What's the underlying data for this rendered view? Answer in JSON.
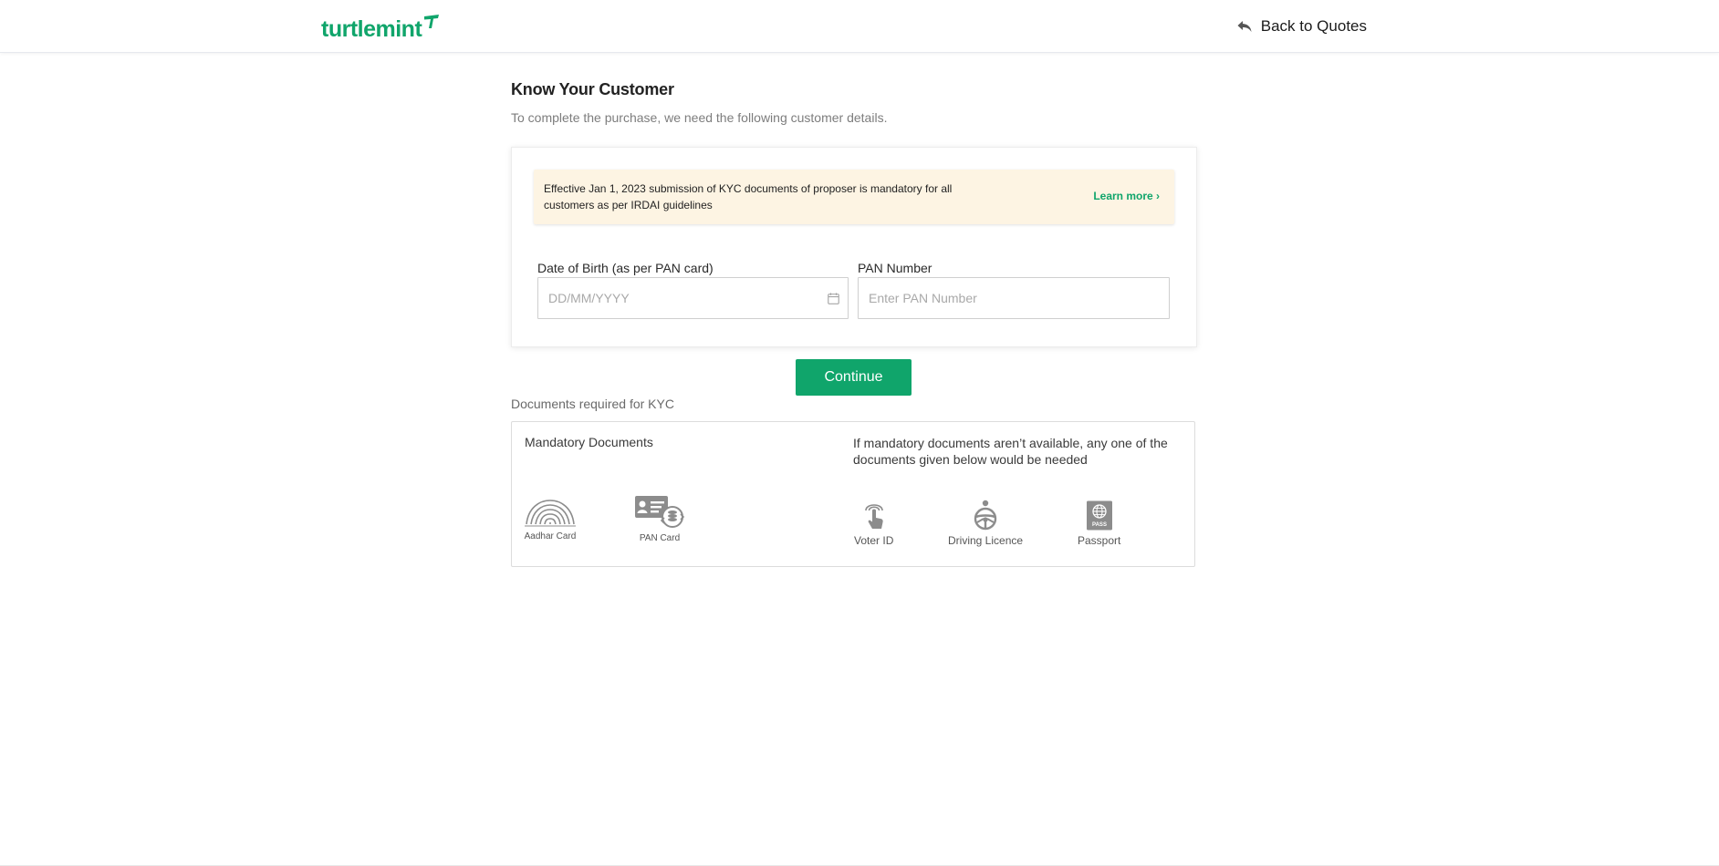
{
  "header": {
    "logo_text": "turtlemint",
    "back_label": "Back to Quotes",
    "brand_color": "#10a56b"
  },
  "page": {
    "title": "Know Your Customer",
    "subtitle": "To complete the purchase, we need the following customer details."
  },
  "notice": {
    "text": "Effective Jan 1, 2023 submission of KYC documents of proposer is mandatory for all customers as per IRDAI guidelines",
    "learn_more": "Learn more ›"
  },
  "form": {
    "dob_label": "Date of Birth (as per PAN card)",
    "dob_placeholder": "DD/MM/YYYY",
    "dob_value": "",
    "pan_label": "PAN Number",
    "pan_placeholder": "Enter PAN Number",
    "pan_value": "",
    "continue_label": "Continue"
  },
  "documents": {
    "heading": "Documents required for KYC",
    "mandatory_title": "Mandatory Documents",
    "mandatory": [
      {
        "label": "Aadhar Card",
        "icon": "fingerprint-icon"
      },
      {
        "label": "PAN Card",
        "icon": "pan-card-icon"
      }
    ],
    "alternate_title": "If mandatory documents aren’t available, any one of the documents given below would be needed",
    "alternate": [
      {
        "label": "Voter ID",
        "icon": "voter-touch-icon"
      },
      {
        "label": "Driving Licence",
        "icon": "steering-wheel-icon"
      },
      {
        "label": "Passport",
        "icon": "passport-icon"
      }
    ]
  }
}
